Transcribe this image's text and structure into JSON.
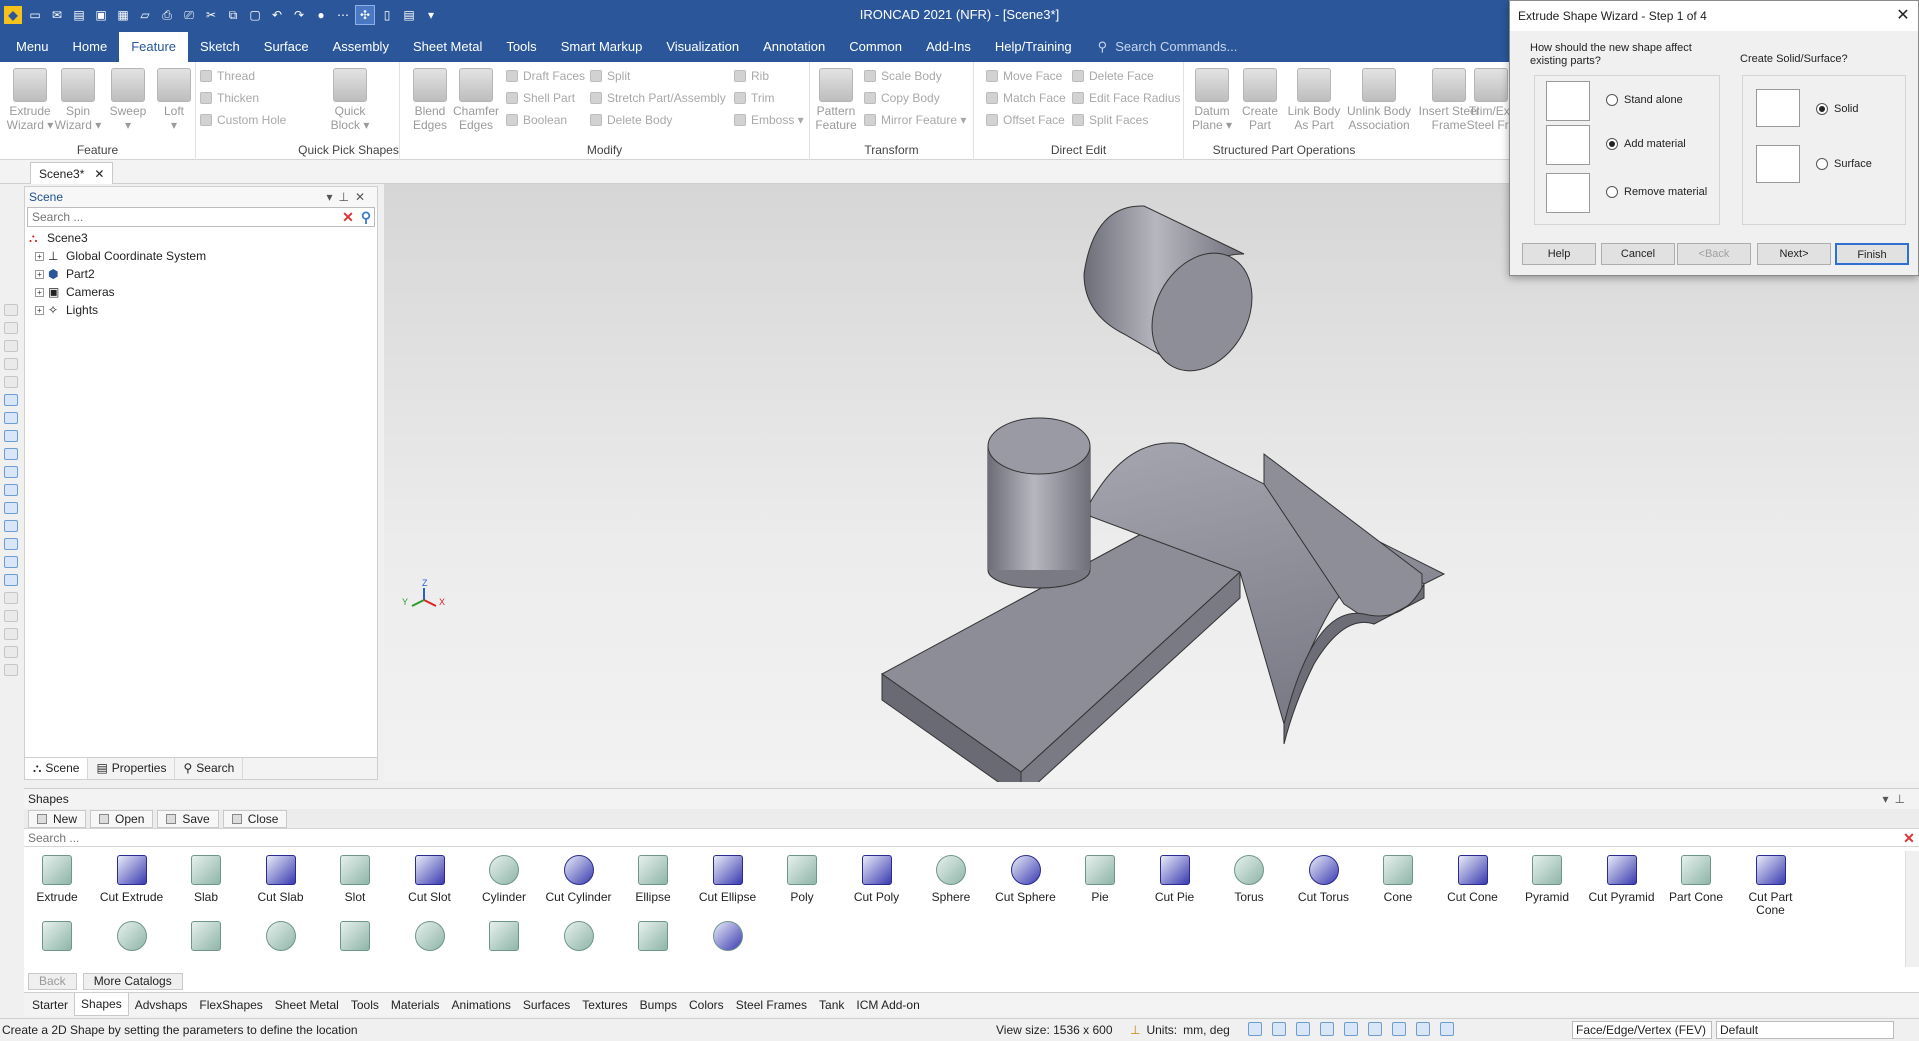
{
  "window": {
    "title": "IRONCAD 2021 (NFR) - [Scene3*]"
  },
  "menu": {
    "tabs": [
      "Menu",
      "Home",
      "Feature",
      "Sketch",
      "Surface",
      "Assembly",
      "Sheet Metal",
      "Tools",
      "Smart Markup",
      "Visualization",
      "Annotation",
      "Common",
      "Add-Ins",
      "Help/Training"
    ],
    "active": "Feature",
    "search_placeholder": "Search Commands..."
  },
  "ribbon": {
    "feature": {
      "label": "Feature",
      "big": [
        {
          "l1": "Extrude",
          "l2": "Wizard ▾"
        },
        {
          "l1": "Spin",
          "l2": "Wizard ▾"
        },
        {
          "l1": "Sweep",
          "l2": "▾"
        },
        {
          "l1": "Loft",
          "l2": "▾"
        }
      ],
      "small": [
        "Thread",
        "Thicken",
        "Custom Hole"
      ]
    },
    "quickpick": {
      "label": "Quick Pick Shapes",
      "big": [
        {
          "l1": "Quick",
          "l2": "Block ▾"
        }
      ]
    },
    "modify": {
      "label": "Modify",
      "big": [
        {
          "l1": "Blend",
          "l2": "Edges"
        },
        {
          "l1": "Chamfer",
          "l2": "Edges"
        }
      ],
      "col1": [
        "Draft Faces",
        "Shell Part",
        "Boolean"
      ],
      "col2": [
        "Split",
        "Stretch Part/Assembly",
        "Delete Body"
      ],
      "col3": [
        "Rib",
        "Trim",
        "Emboss ▾"
      ]
    },
    "transform": {
      "label": "Transform",
      "big": [
        {
          "l1": "Pattern",
          "l2": "Feature"
        }
      ],
      "small": [
        "Scale Body",
        "Copy Body",
        "Mirror Feature ▾"
      ]
    },
    "directedit": {
      "label": "Direct Edit",
      "col1": [
        "Move Face",
        "Match Face",
        "Offset Face"
      ],
      "col2": [
        "Delete Face",
        "Edit Face Radius",
        "Split Faces"
      ]
    },
    "structured": {
      "label": "Structured Part Operations",
      "big": [
        {
          "l1": "Datum",
          "l2": "Plane ▾"
        },
        {
          "l1": "Create",
          "l2": "Part"
        },
        {
          "l1": "Link Body",
          "l2": "As Part"
        },
        {
          "l1": "Unlink Body",
          "l2": "Association"
        },
        {
          "l1": "Insert Steel",
          "l2": "Frame"
        },
        {
          "l1": "Trim/Ext",
          "l2": "Steel Fra"
        }
      ]
    }
  },
  "doc_tab": {
    "label": "Scene3*"
  },
  "scene_panel": {
    "title": "Scene",
    "search_placeholder": "Search ...",
    "tree": [
      {
        "label": "Scene3",
        "root": true
      },
      {
        "label": "Global Coordinate System"
      },
      {
        "label": "Part2"
      },
      {
        "label": "Cameras"
      },
      {
        "label": "Lights"
      }
    ],
    "tabs": [
      "Scene",
      "Properties",
      "Search"
    ]
  },
  "dialog": {
    "title": "Extrude Shape Wizard - Step 1 of 4",
    "question": "How should the new shape affect existing parts?",
    "options": [
      {
        "label": "Stand alone",
        "on": false
      },
      {
        "label": "Add material",
        "on": true
      },
      {
        "label": "Remove material",
        "on": false
      }
    ],
    "question2": "Create Solid/Surface?",
    "options2": [
      {
        "label": "Solid",
        "on": true
      },
      {
        "label": "Surface",
        "on": false
      }
    ],
    "buttons": {
      "help": "Help",
      "cancel": "Cancel",
      "back": "<Back",
      "next": "Next>",
      "finish": "Finish"
    }
  },
  "viewport": {
    "axes": {
      "z": "Z",
      "y": "Y",
      "x": "X"
    }
  },
  "shapes_panel": {
    "title": "Shapes",
    "toolbar": [
      "New",
      "Open",
      "Save",
      "Close"
    ],
    "search_placeholder": "Search ...",
    "items": [
      "Extrude",
      "Cut Extrude",
      "Slab",
      "Cut Slab",
      "Slot",
      "Cut Slot",
      "Cylinder",
      "Cut Cylinder",
      "Ellipse",
      "Cut Ellipse",
      "Poly",
      "Cut Poly",
      "Sphere",
      "Cut Sphere",
      "Pie",
      "Cut Pie",
      "Torus",
      "Cut Torus",
      "Cone",
      "Cut Cone",
      "Pyramid",
      "Cut Pyramid",
      "Part Cone",
      "Cut Part Cone"
    ],
    "back_label": "Back",
    "more_label": "More Catalogs"
  },
  "catalog_tabs": {
    "items": [
      "Starter",
      "Shapes",
      "Advshaps",
      "FlexShapes",
      "Sheet Metal",
      "Tools",
      "Materials",
      "Animations",
      "Surfaces",
      "Textures",
      "Bumps",
      "Colors",
      "Steel Frames",
      "Tank",
      "ICM Add-on"
    ],
    "active": "Shapes"
  },
  "status": {
    "message": "Create a 2D Shape by setting the parameters to define the location",
    "view_size": "View size: 1536 x  600",
    "units_label": "Units:",
    "units_value": "mm, deg",
    "selection_mode": "Face/Edge/Vertex (FEV)",
    "style": "Default"
  },
  "colors": {
    "accent": "#2b579a",
    "part": "#8e8e99"
  }
}
